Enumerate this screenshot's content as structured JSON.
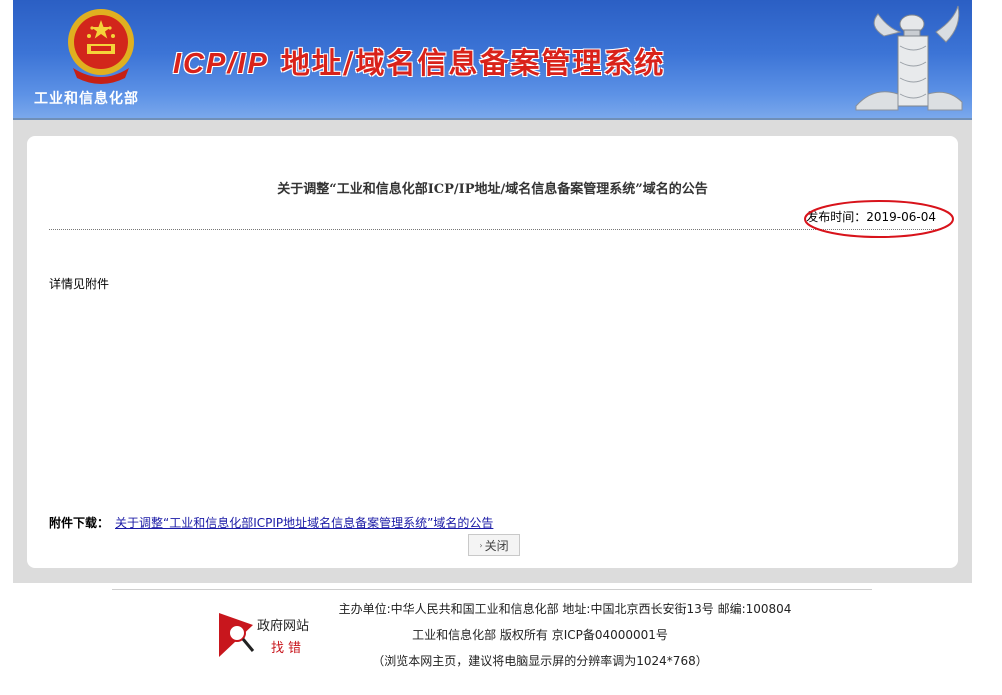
{
  "header": {
    "ministry_name": "工业和信息化部",
    "system_title_latin": "ICP/IP",
    "system_title_cn": " 地址/域名信息备案管理系统"
  },
  "notice": {
    "title": "关于调整“工业和信息化部ICP/IP地址/域名信息备案管理系统”域名的公告",
    "publish_date": "发布时间：2019-06-04",
    "body": "详情见附件",
    "attachment_label": "附件下载：",
    "attachment_link": "关于调整“工业和信息化部ICPIP地址域名信息备案管理系统”域名的公告 ",
    "close_label": "关闭"
  },
  "footer": {
    "line1": "主办单位:中华人民共和国工业和信息化部 地址:中国北京西长安街13号 邮编:100804",
    "line2": "工业和信息化部 版权所有 京ICP备04000001号",
    "line3": "（浏览本网主页，建议将电脑显示屏的分辨率调为1024*768）",
    "gov_logo_line1": "政府网站",
    "gov_logo_line2": "找错"
  },
  "colors": {
    "header_blue": "#3c74d6",
    "title_red": "#d9221a",
    "annotation_red": "#d8131b",
    "link_blue": "#1a1aa6"
  }
}
